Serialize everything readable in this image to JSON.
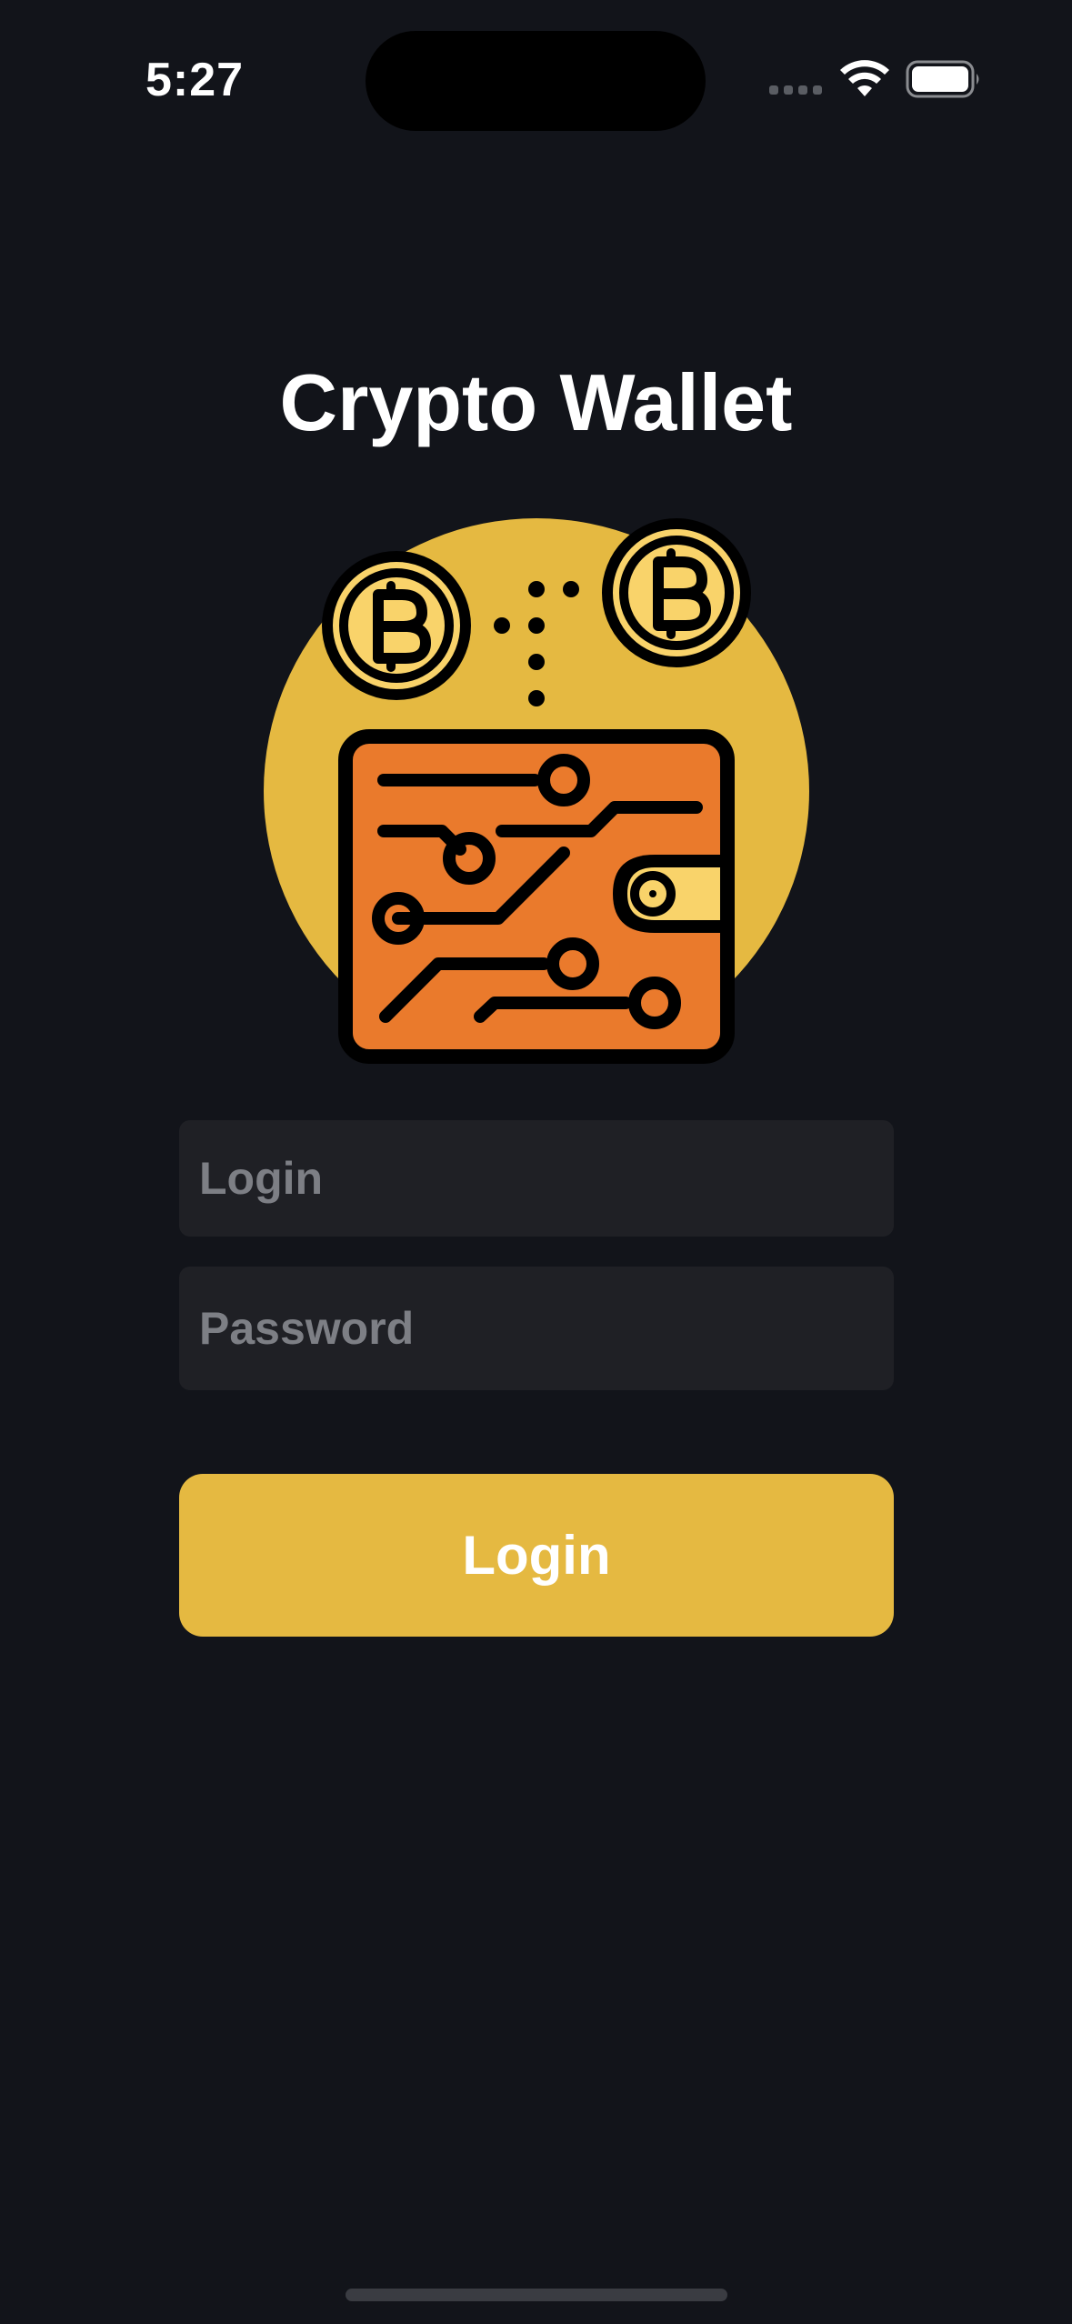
{
  "status_bar": {
    "time": "5:27",
    "icons": [
      "signal-dots-icon",
      "wifi-icon",
      "battery-icon"
    ]
  },
  "title": "Crypto Wallet",
  "illustration": {
    "icon": "crypto-wallet-illustration",
    "colors": {
      "circle": "#e5b941",
      "wallet": "#ea7a2c",
      "coin": "#f9d36a",
      "outline": "#000000"
    }
  },
  "form": {
    "login_placeholder": "Login",
    "login_value": "",
    "password_placeholder": "Password",
    "password_value": "",
    "submit_label": "Login"
  },
  "colors": {
    "background": "#12141a",
    "field_background": "#1f2025",
    "accent": "#e5b941",
    "placeholder": "#7d7f85"
  }
}
